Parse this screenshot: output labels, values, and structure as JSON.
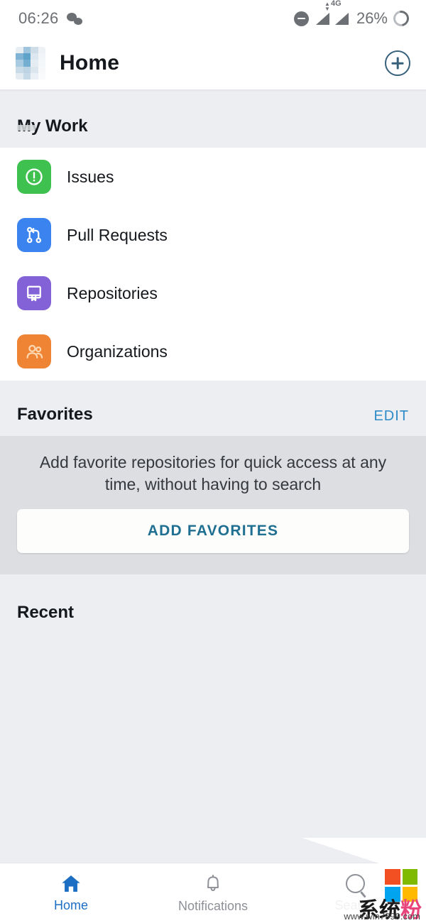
{
  "statusbar": {
    "time": "06:26",
    "wechat_icon": "wechat-icon",
    "dnd_icon": "do-not-disturb-icon",
    "network_label": "4G",
    "signal_icon": "signal-bars-icon",
    "battery_percent": "26%",
    "battery_icon": "battery-ring-icon",
    "text_color": "#6c6f74"
  },
  "appbar": {
    "avatar_name": "user-avatar",
    "title": "Home",
    "add_icon": "plus-circle-icon",
    "add_icon_color": "#36607c"
  },
  "my_work": {
    "title": "My Work",
    "items": [
      {
        "label": "Issues",
        "icon": "issue-opened-icon",
        "color": "#3fc14f"
      },
      {
        "label": "Pull Requests",
        "icon": "git-pull-request-icon",
        "color": "#3b84f0"
      },
      {
        "label": "Repositories",
        "icon": "repo-book-icon",
        "color": "#8361d6"
      },
      {
        "label": "Organizations",
        "icon": "organization-people-icon",
        "color": "#ef8434"
      }
    ]
  },
  "favorites": {
    "title": "Favorites",
    "edit_label": "EDIT",
    "edit_color": "#2d8bc7",
    "empty_text": "Add favorite repositories for quick access at any time, without having to search",
    "button_label": "ADD FAVORITES",
    "button_text_color": "#1e6f91"
  },
  "recent": {
    "title": "Recent",
    "items": []
  },
  "bottom_nav": {
    "items": [
      {
        "label": "Home",
        "icon": "home-icon",
        "active": true,
        "color": "#1d6fc4"
      },
      {
        "label": "Notifications",
        "icon": "bell-icon",
        "active": false,
        "color": "#8d9096"
      },
      {
        "label": "Search",
        "icon": "search-icon",
        "active": false,
        "color": "#8d9096"
      }
    ]
  },
  "watermark": {
    "brand_cn_1": "系统",
    "brand_cn_2": "粉",
    "url": "www.win7999.com",
    "logo_colors": [
      "#f25022",
      "#7fba00",
      "#00a4ef",
      "#ffb900"
    ]
  }
}
